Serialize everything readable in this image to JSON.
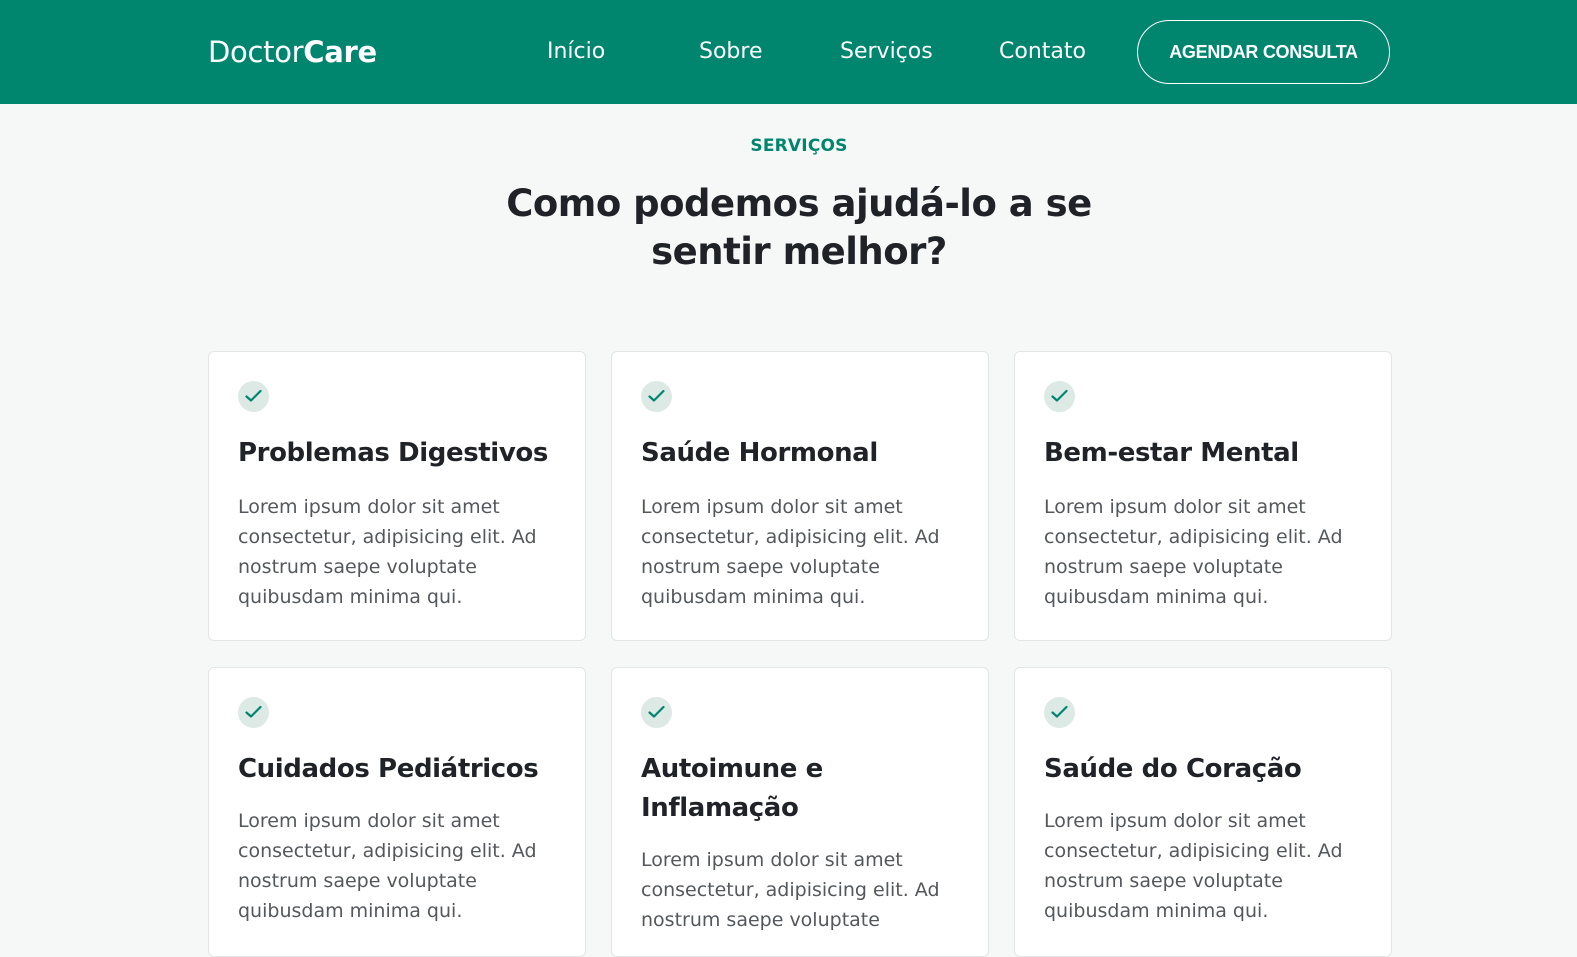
{
  "header": {
    "logo_light": "Doctor",
    "logo_bold": "Care",
    "nav": [
      "Início",
      "Sobre",
      "Serviços",
      "Contato"
    ],
    "cta_label": "AGENDAR CONSULTA"
  },
  "section": {
    "eyebrow": "SERVIÇOS",
    "title": "Como podemos ajudá-lo a se sentir melhor?"
  },
  "cards": [
    {
      "title": "Problemas Digestivos",
      "text": "Lorem ipsum dolor sit amet consectetur, adipisicing elit. Ad nostrum saepe voluptate quibusdam minima qui."
    },
    {
      "title": "Saúde Hormonal",
      "text": "Lorem ipsum dolor sit amet consectetur, adipisicing elit. Ad nostrum saepe voluptate quibusdam minima qui."
    },
    {
      "title": "Bem-estar Mental",
      "text": "Lorem ipsum dolor sit amet consectetur, adipisicing elit. Ad nostrum saepe voluptate quibusdam minima qui."
    },
    {
      "title": "Cuidados Pediátricos",
      "text": "Lorem ipsum dolor sit amet consectetur, adipisicing elit. Ad nostrum saepe voluptate quibusdam minima qui."
    },
    {
      "title": "Autoimune e Inflamação",
      "text": "Lorem ipsum dolor sit amet consectetur, adipisicing elit. Ad nostrum saepe voluptate"
    },
    {
      "title": "Saúde do Coração",
      "text": "Lorem ipsum dolor sit amet consectetur, adipisicing elit. Ad nostrum saepe voluptate quibusdam minima qui."
    }
  ],
  "icons": {
    "card": "check-icon"
  },
  "colors": {
    "brand": "#00856f",
    "check_bg": "#dde9e4",
    "page_bg": "#f6f7f7"
  }
}
